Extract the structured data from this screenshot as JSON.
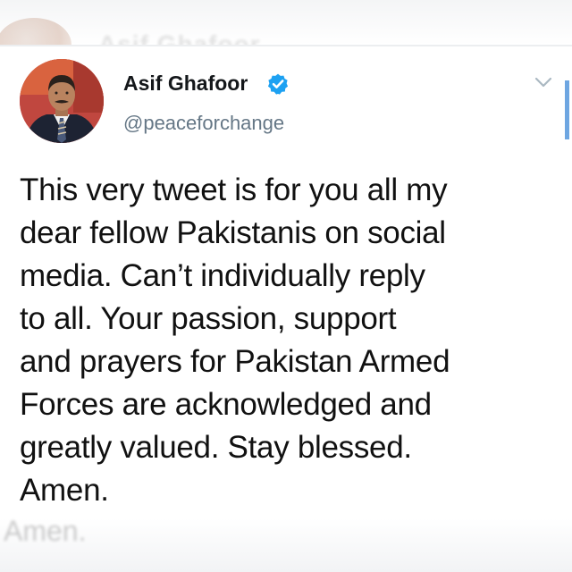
{
  "ghost": {
    "top_name": "Asif Ghafoor",
    "bottom_text": "Amen."
  },
  "profile": {
    "display_name": "Asif Ghafoor",
    "handle": "@peaceforchange",
    "verified": true,
    "avatar_icon": "profile-photo"
  },
  "tweet": {
    "lines": [
      "This very tweet is for you all my",
      "dear fellow Pakistanis on social",
      "media. Can’t individually reply",
      "to all. Your passion, support",
      "and prayers for Pakistan Armed",
      "Forces are acknowledged and",
      "greatly valued. Stay blessed.",
      "Amen."
    ]
  },
  "icons": {
    "verified": "verified-badge-icon",
    "menu": "chevron-down-icon"
  },
  "colors": {
    "verified_blue": "#1da1f2",
    "handle_gray": "#657786",
    "chevron_gray": "#aab8c2"
  }
}
